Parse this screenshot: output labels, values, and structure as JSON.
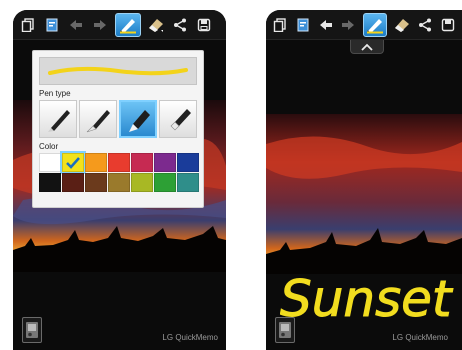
{
  "pen_panel": {
    "pen_type_label": "Pen type",
    "color_label": "Color",
    "preview_color": "#f3d31a",
    "selected_pen_index": 2,
    "pens": [
      "ballpoint-pen-icon",
      "fountain-pen-icon",
      "marker-pen-icon",
      "highlighter-pen-icon"
    ],
    "colors": [
      "#ffffff",
      "#f2e21b",
      "#f59a1c",
      "#e83c2e",
      "#c62a52",
      "#7c2a8e",
      "#1a3c9a",
      "#121212",
      "#5a1f15",
      "#6b3a1c",
      "#9a7a2c",
      "#a8b824",
      "#2da035",
      "#2f8e8a"
    ],
    "selected_color_index": 1
  },
  "left_screen": {
    "watermark": "LG QuickMemo"
  },
  "right_screen": {
    "watermark": "LG QuickMemo",
    "handwritten_text": "Sunset",
    "ink_color": "#f2dd1f"
  },
  "toolbar": {
    "icons": [
      "copy-icon",
      "notes-icon",
      "undo-icon",
      "redo-icon",
      "pen-icon",
      "eraser-icon",
      "share-icon",
      "save-icon"
    ],
    "active_icon": "pen-icon"
  }
}
